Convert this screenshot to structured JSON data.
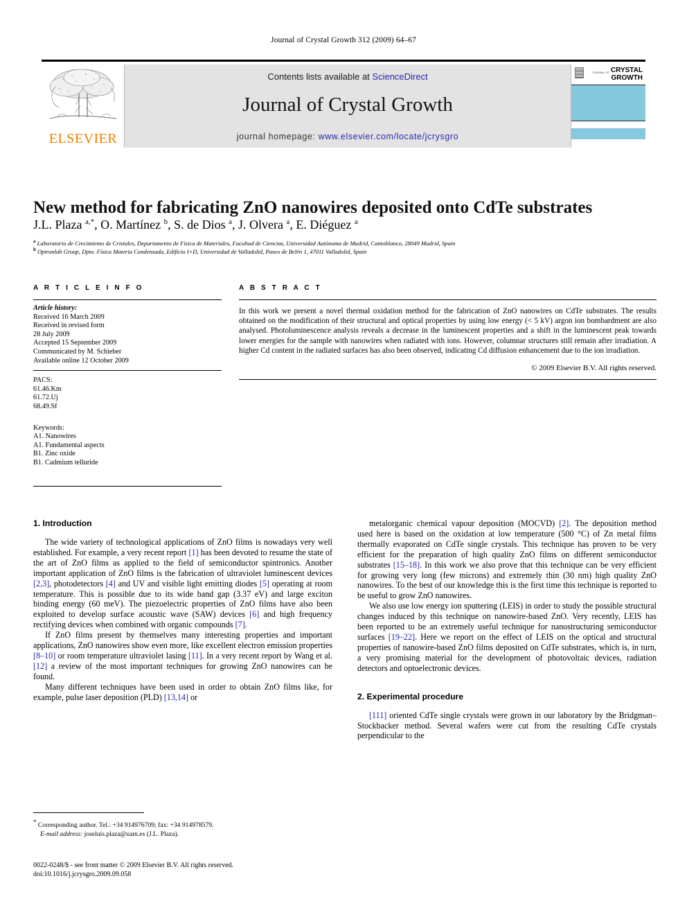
{
  "running_head": "Journal of Crystal Growth 312 (2009) 64–67",
  "banner": {
    "publisher_logo_label": "ELSEVIER",
    "contents_prefix": "Contents lists available at ",
    "contents_link": "ScienceDirect",
    "journal_name": "Journal of Crystal Growth",
    "homepage_prefix": "journal homepage: ",
    "homepage_url": "www.elsevier.com/locate/jcrysgro",
    "cover": {
      "journal_of": "JOURNAL OF",
      "title_line1": "CRYSTAL",
      "title_line2": "GROWTH",
      "band_color": "#86c9de"
    }
  },
  "article": {
    "title": "New method for fabricating ZnO nanowires deposited onto CdTe substrates",
    "authors_html": "J.L. Plaza <sup>a,*</sup>, O. Martínez <sup>b</sup>, S. de Dios <sup>a</sup>, J. Olvera <sup>a</sup>, E. Diéguez <sup>a</sup>",
    "affiliation_a": "Laboratorio de Crecimiento de Cristales, Departamento de Física de Materiales, Facultad de Ciencias, Universidad Autónoma de Madrid, Cantoblanco, 28049 Madrid, Spain",
    "affiliation_b": "Optronlab Group, Dpto. Física Materia Condensada, Edificio I+D, Universidad de Valladolid, Paseo de Belén 1, 47011 Valladolid, Spain"
  },
  "article_info": {
    "heading": "A R T I C L E   I N F O",
    "history_label": "Article history:",
    "history_lines": [
      "Received 16 March 2009",
      "Received in revised form",
      "28 July 2009",
      "Accepted 15 September 2009",
      "Communicated by M. Schieber",
      "Available online 12 October 2009"
    ],
    "pacs_label": "PACS:",
    "pacs": [
      "61.46.Km",
      "61.72.Uj",
      "68.49.Sf"
    ],
    "keywords_label": "Keywords:",
    "keywords": [
      "A1. Nanowires",
      "A1. Fundamental aspects",
      "B1. Zinc oxide",
      "B1. Cadmium telluride"
    ]
  },
  "abstract": {
    "heading": "A B S T R A C T",
    "text": "In this work we present a novel thermal oxidation method for the fabrication of ZnO nanowires on CdTe substrates. The results obtained on the modification of their structural and optical properties by using low energy (< 5 kV) argon ion bombardment are also analysed. Photoluminescence analysis reveals a decrease in the luminescent properties and a shift in the luminescent peak towards lower energies for the sample with nanowires when radiated with ions. However, columnar structures still remain after irradiation. A higher Cd content in the radiated surfaces has also been observed, indicating Cd diffusion enhancement due to the ion irradiation.",
    "copyright": "© 2009 Elsevier B.V. All rights reserved."
  },
  "body": {
    "section1_heading": "1. Introduction",
    "section2_heading": "2. Experimental procedure",
    "left_paragraphs": [
      "The wide variety of technological applications of ZnO films is nowadays very well established. For example, a very recent report [1] has been devoted to resume the state of the art of ZnO films as applied to the field of semiconductor spintronics. Another important application of ZnO films is the fabrication of ultraviolet luminescent devices [2,3], photodetectors [4] and UV and visible light emitting diodes [5] operating at room temperature. This is possible due to its wide band gap (3.37 eV) and large exciton binding energy (60 meV). The piezoelectric properties of ZnO films have also been exploited to develop surface acoustic wave (SAW) devices [6] and high frequency rectifying devices when combined with organic compounds [7].",
      "If ZnO films present by themselves many interesting properties and important applications, ZnO nanowires show even more, like excellent electron emission properties [8–10] or room temperature ultraviolet lasing [11]. In a very recent report by Wang et al. [12] a review of the most important techniques for growing ZnO nanowires can be found.",
      "Many different techniques have been used in order to obtain ZnO films like, for example, pulse laser deposition (PLD) [13,14] or"
    ],
    "right_paragraphs": [
      "metalorganic chemical vapour deposition (MOCVD) [2]. The deposition method used here is based on the oxidation at low temperature (500 °C) of Zn metal films thermally evaporated on CdTe single crystals. This technique has proven to be very efficient for the preparation of high quality ZnO films on different semiconductor substrates [15–18]. In this work we also prove that this technique can be very efficient for growing very long (few microns) and extremely thin (30 nm) high quality ZnO nanowires. To the best of our knowledge this is the first time this technique is reported to be useful to grow ZnO nanowires.",
      "We also use low energy ion sputtering (LEIS) in order to study the possible structural changes induced by this technique on nanowire-based ZnO. Very recently, LEIS has been reported to be an extremely useful technique for nanostructuring semiconductor surfaces [19–22]. Here we report on the effect of LEIS on the optical and structural properties of nanowire-based ZnO films deposited on CdTe substrates, which is, in turn, a very promising material for the development of photovoltaic devices, radiation detectors and optoelectronic devices."
    ],
    "section2_paragraph": "[111] oriented CdTe single crystals were grown in our laboratory by the Bridgman–Stockbacker method. Several wafers were cut from the resulting CdTe crystals perpendicular to the"
  },
  "footer": {
    "corresponding_note": "Corresponding author. Tel.: +34 914976709; fax: +34 914978579.",
    "email_label": "E-mail address:",
    "email_value": "joseluis.plaza@uam.es (J.L. Plaza).",
    "imprint_line1": "0022-0248/$ - see front matter © 2009 Elsevier B.V. All rights reserved.",
    "imprint_line2": "doi:10.1016/j.jcrysgro.2009.09.058"
  }
}
